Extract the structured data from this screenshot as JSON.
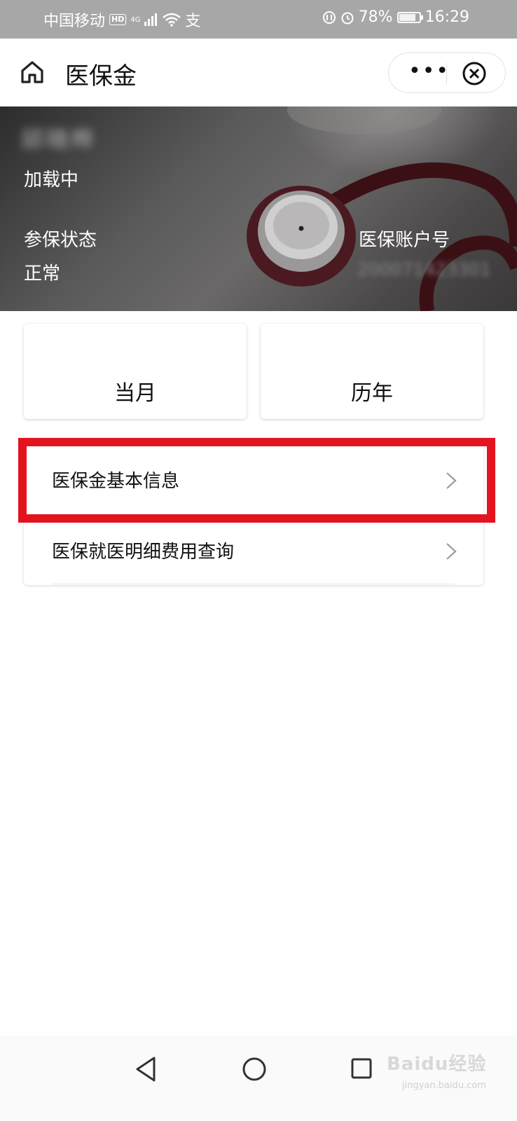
{
  "status_bar": {
    "carrier": "中国移动",
    "hd": "HD",
    "signal": "4G",
    "pay": "支",
    "battery": "78%",
    "time": "16:29"
  },
  "header": {
    "title": "医保金",
    "more": "•••"
  },
  "banner": {
    "name": "邱晓晔",
    "loading": "加载中",
    "status_label": "参保状态",
    "status_value": "正常",
    "account_label": "医保账户号",
    "account_value": "200071423301"
  },
  "cards": [
    {
      "label": "当月"
    },
    {
      "label": "历年"
    }
  ],
  "list": [
    {
      "label": "医保金基本信息"
    },
    {
      "label": "医保就医明细费用查询"
    }
  ],
  "watermark": {
    "brand": "Baidu经验",
    "url": "jingyan.baidu.com"
  },
  "colors": {
    "highlight": "#e3141f",
    "status_bar": "#a7a7a7"
  }
}
